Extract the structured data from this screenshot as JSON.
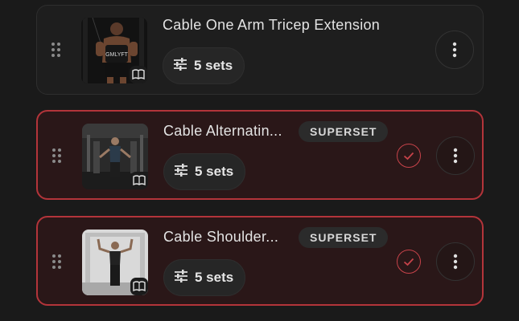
{
  "exercises": [
    {
      "name": "Cable One Arm Tricep Extension",
      "sets_label": "5 sets",
      "badge": "",
      "selected": false,
      "thumbnail": "athlete-cable-tricep-image",
      "shirt_text": "GMLYFT"
    },
    {
      "name": "Cable Alternatin...",
      "sets_label": "5 sets",
      "badge": "SUPERSET",
      "selected": true,
      "thumbnail": "athlete-cable-gym-image"
    },
    {
      "name": "Cable Shoulder...",
      "sets_label": "5 sets",
      "badge": "SUPERSET",
      "selected": true,
      "thumbnail": "athlete-shoulder-cable-image"
    }
  ],
  "colors": {
    "background": "#1a1a1a",
    "card": "#1e1e1e",
    "selected_card": "#2a1718",
    "selected_border": "#b3343a",
    "accent_check": "#c7434a"
  },
  "icons": {
    "drag": "drag-handle-icon",
    "sets": "sliders-icon",
    "guide": "book-icon",
    "check": "check-circle-icon",
    "more": "more-vertical-icon"
  }
}
